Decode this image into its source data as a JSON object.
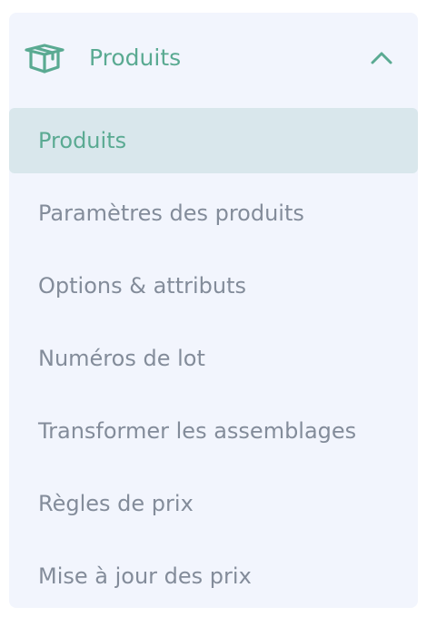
{
  "section": {
    "title": "Produits",
    "icon": "box-icon",
    "toggle_icon": "chevron-up-icon",
    "expanded": true
  },
  "colors": {
    "accent": "#5aaa92",
    "text_muted": "#838c9a",
    "panel_bg": "#f2f5fd",
    "active_bg": "#d9e7ec"
  },
  "menu": {
    "items": [
      {
        "label": "Produits",
        "active": true
      },
      {
        "label": "Paramètres des produits",
        "active": false
      },
      {
        "label": "Options & attributs",
        "active": false
      },
      {
        "label": "Numéros de lot",
        "active": false
      },
      {
        "label": "Transformer les assemblages",
        "active": false
      },
      {
        "label": "Règles de prix",
        "active": false
      },
      {
        "label": "Mise à jour des prix",
        "active": false
      }
    ]
  }
}
